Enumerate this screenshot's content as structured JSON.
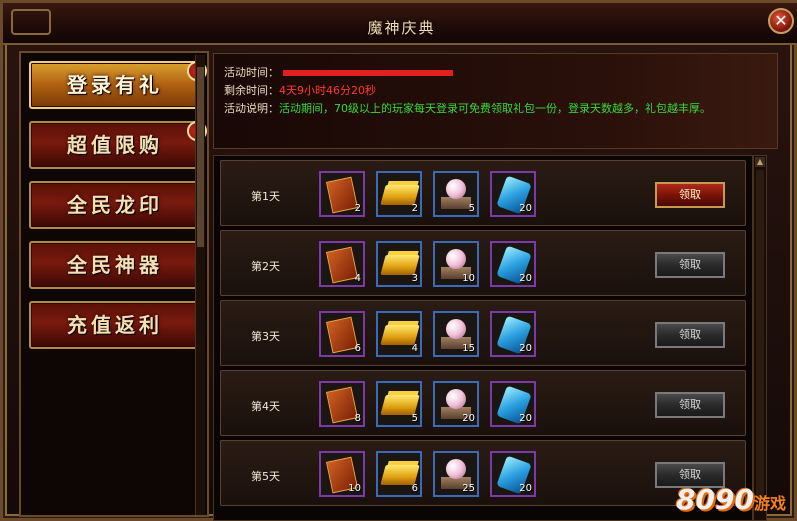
{
  "window": {
    "title": "魔神庆典"
  },
  "sidebar": {
    "items": [
      {
        "label": "登录有礼",
        "badge": "!"
      },
      {
        "label": "超值限购",
        "badge": "!"
      },
      {
        "label": "全民龙印",
        "badge": ""
      },
      {
        "label": "全民神器",
        "badge": ""
      },
      {
        "label": "充值返利",
        "badge": ""
      }
    ]
  },
  "info": {
    "time_label": "活动时间：",
    "remain_label": "剩余时间：",
    "remain_value": "4天9小时46分20秒",
    "desc_label": "活动说明：",
    "desc_value": "活动期间，70级以上的玩家每天登录可免费领取礼包一份，登录天数越多，礼包越丰厚。"
  },
  "days": [
    {
      "label": "第1天",
      "counts": [
        "2",
        "2",
        "5",
        "20"
      ],
      "claim": "领取"
    },
    {
      "label": "第2天",
      "counts": [
        "4",
        "3",
        "10",
        "20"
      ],
      "claim": "领取"
    },
    {
      "label": "第3天",
      "counts": [
        "6",
        "4",
        "15",
        "20"
      ],
      "claim": "领取"
    },
    {
      "label": "第4天",
      "counts": [
        "8",
        "5",
        "20",
        "20"
      ],
      "claim": "领取"
    },
    {
      "label": "第5天",
      "counts": [
        "10",
        "6",
        "25",
        "20"
      ],
      "claim": "领取"
    }
  ],
  "item_icons": [
    "token-card-icon",
    "gold-bars-icon",
    "pearl-icon",
    "crystal-icon"
  ],
  "colors": {
    "remain": "#ff3a2a",
    "description": "#3ad83a",
    "active_menu": "#d8a030",
    "claim_active": "#b02a1a"
  },
  "watermark": {
    "main": "8090",
    "sub": "游戏"
  }
}
